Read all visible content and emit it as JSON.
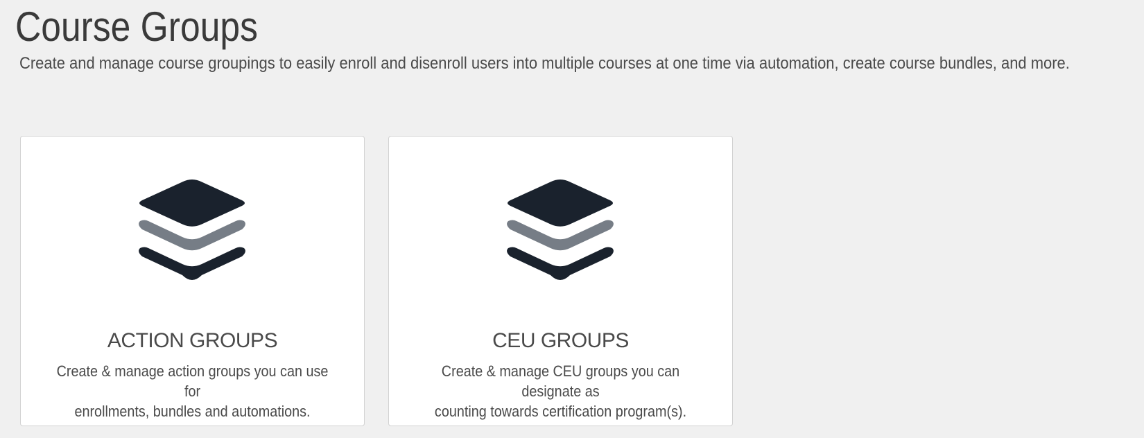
{
  "header": {
    "title": "Course Groups",
    "subtitle": "Create and manage course groupings to easily enroll and disenroll users into multiple courses at one time via automation, create course bundles, and more."
  },
  "cards": [
    {
      "icon": "layers-icon",
      "title": "ACTION GROUPS",
      "description_line1": "Create & manage action groups you can use for",
      "description_line2": "enrollments, bundles and automations."
    },
    {
      "icon": "layers-icon",
      "title": "CEU GROUPS",
      "description_line1": "Create & manage CEU groups you can designate as",
      "description_line2": "counting towards certification program(s)."
    }
  ],
  "colors": {
    "background": "#f0f0f0",
    "card_background": "#ffffff",
    "icon_dark": "#1a222d",
    "icon_gray": "#767d86",
    "text": "#4a4a4a"
  }
}
